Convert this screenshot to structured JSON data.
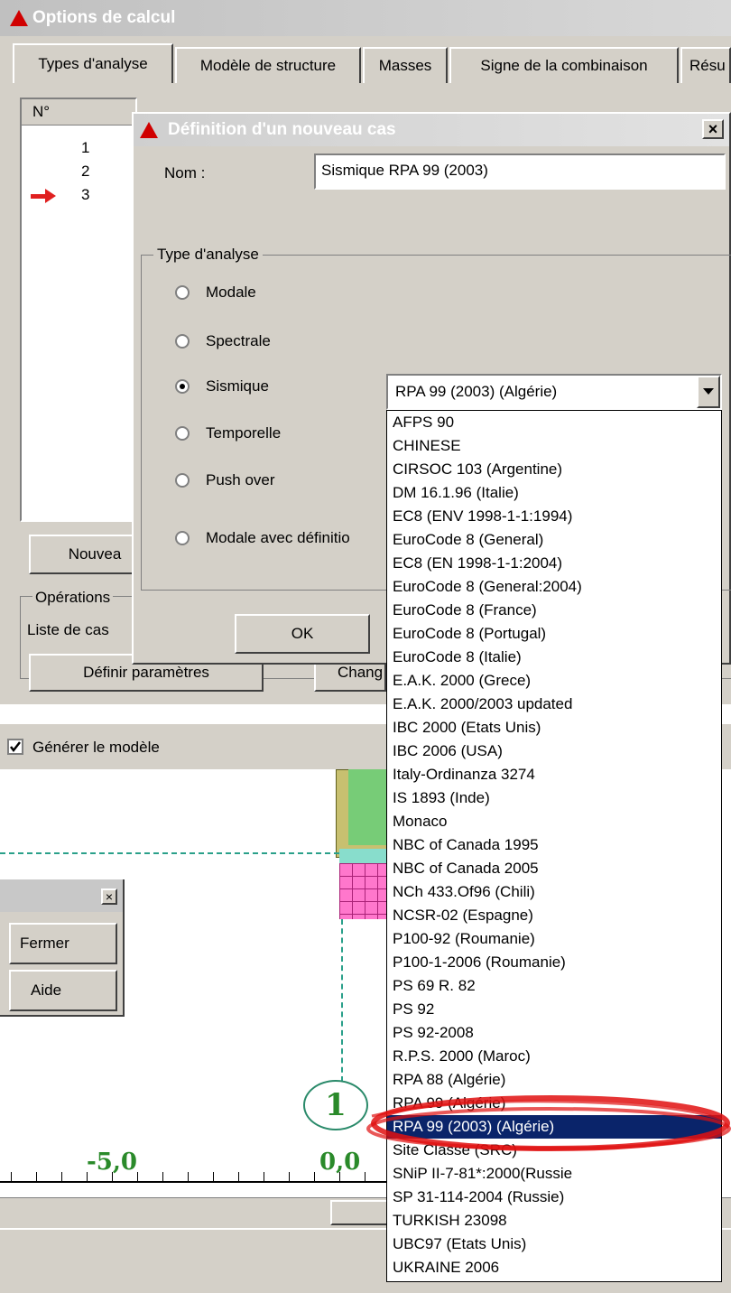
{
  "outer_window": {
    "title": "Options de calcul",
    "tabs": [
      "Types d'analyse",
      "Modèle de structure",
      "Masses",
      "Signe de la combinaison",
      "Résu"
    ],
    "list_header": "N°",
    "list_rows": [
      "1",
      "2",
      "3"
    ],
    "new_button": "Nouvea",
    "operations_label": "Opérations",
    "case_list_label": "Liste de cas",
    "define_params_button": "Définir paramètres",
    "change_button": "Chang",
    "generate_model_label": "Générer le modèle"
  },
  "dialog": {
    "title": "Définition d'un nouveau cas",
    "close_glyph": "×",
    "name_label": "Nom :",
    "name_value": "Sismique RPA 99 (2003)",
    "group_label": "Type d'analyse",
    "radios": [
      {
        "label": "Modale",
        "checked": false
      },
      {
        "label": "Spectrale",
        "checked": false
      },
      {
        "label": "Sismique",
        "checked": true
      },
      {
        "label": "Temporelle",
        "checked": false
      },
      {
        "label": "Push over",
        "checked": false
      },
      {
        "label": "Modale avec définitio",
        "checked": false
      }
    ],
    "ok_button": "OK",
    "select_value": "RPA 99 (2003) (Algérie)"
  },
  "dropdown_options": [
    "AFPS 90",
    "CHINESE",
    "CIRSOC 103 (Argentine)",
    "DM 16.1.96 (Italie)",
    "EC8 (ENV 1998-1-1:1994)",
    "EuroCode 8 (General)",
    "EC8 (EN 1998-1-1:2004)",
    "EuroCode 8 (General:2004)",
    "EuroCode 8 (France)",
    "EuroCode 8 (Portugal)",
    "EuroCode 8 (Italie)",
    "E.A.K. 2000 (Grece)",
    "E.A.K. 2000/2003 updated",
    "IBC 2000 (Etats Unis)",
    "IBC 2006 (USA)",
    "Italy-Ordinanza 3274",
    "IS 1893 (Inde)",
    "Monaco",
    "NBC of Canada 1995",
    "NBC of Canada 2005",
    "NCh 433.Of96 (Chili)",
    "NCSR-02 (Espagne)",
    "P100-92 (Roumanie)",
    "P100-1-2006 (Roumanie)",
    "PS 69 R. 82",
    "PS 92",
    "PS 92-2008",
    "R.P.S. 2000 (Maroc)",
    "RPA 88 (Algérie)",
    "RPA 99 (Algérie)",
    "RPA 99 (2003) (Algérie)",
    "Site Classe (SRC)",
    "SNiP II-7-81*:2000(Russie",
    "SP 31-114-2004 (Russie)",
    "TURKISH 23098",
    "UBC97 (Etats Unis)",
    "UKRAINE 2006"
  ],
  "selected_option_index": 30,
  "small_panel": {
    "close_glyph": "×",
    "close_button": "Fermer",
    "help_button": "Aide"
  },
  "drawing": {
    "axis_label": "1",
    "tick_labels": [
      "-5,0",
      "0,0"
    ]
  },
  "colors": {
    "title_red": "#d00000",
    "highlight": "#0a246a",
    "annotation": "#e01010",
    "axis_green": "#2a8a2a",
    "grid_magenta": "#ff66cc"
  }
}
